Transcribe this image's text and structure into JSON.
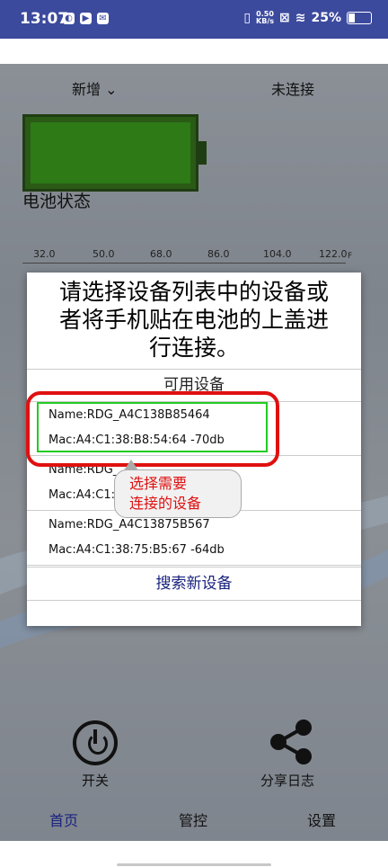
{
  "status_bar": {
    "time": "13:07",
    "net_speed_top": "0.50",
    "net_speed_bottom": "KB/s",
    "battery": "25%"
  },
  "top_nav": {
    "add": "新增",
    "connection": "未连接"
  },
  "battery_status_label": "电池状态",
  "scale_ticks": [
    "32.0",
    "50.0",
    "68.0",
    "86.0",
    "104.0",
    "122.0"
  ],
  "scale_unit": "F",
  "dialog": {
    "prompt_lines": [
      "请选择设备列表中的设备或",
      "者将手机贴在电池的上盖进",
      "行连接。"
    ],
    "header": "可用设备",
    "devices": [
      {
        "name": "Name:RDG_A4C138B85464",
        "mac": "Mac:A4:C1:38:B8:54:64  -70db"
      },
      {
        "name": "Name:RDG_",
        "mac": "Mac:A4:C1:3"
      },
      {
        "name": "Name:RDG_A4C13875B567",
        "mac": "Mac:A4:C1:38:75:B5:67  -64db"
      }
    ],
    "search_button": "搜索新设备"
  },
  "annotation": {
    "line1": "选择需要",
    "line2": "连接的设备"
  },
  "controls": {
    "power": "开关",
    "share": "分享日志"
  },
  "tabs": [
    "首页",
    "管控",
    "设置"
  ],
  "colors": {
    "status_bar": "#3c4a9e",
    "active_tab": "#1a237e",
    "annotation_red": "#e01010",
    "highlight_green": "#22cc22",
    "battery_green": "#2d7a17"
  }
}
